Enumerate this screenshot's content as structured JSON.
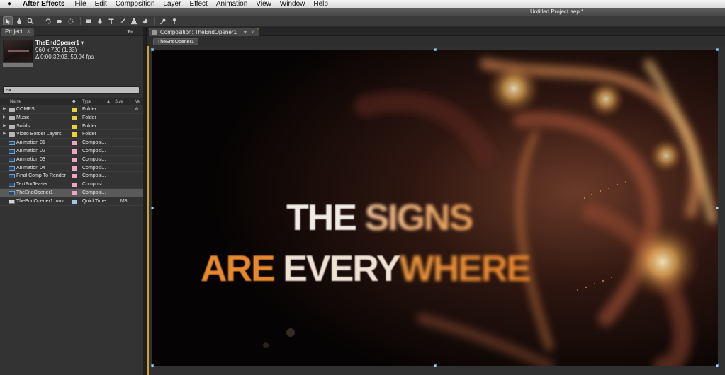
{
  "menubar": {
    "app_name": "After Effects",
    "items": [
      "File",
      "Edit",
      "Composition",
      "Layer",
      "Effect",
      "Animation",
      "View",
      "Window",
      "Help"
    ]
  },
  "window": {
    "title": "Untitled Project.aep *"
  },
  "toolbar": {
    "tools": [
      "selection-tool",
      "hand-tool",
      "zoom-tool",
      "rotation-tool",
      "camera-tool",
      "pan-behind-tool",
      "rectangle-tool",
      "pen-tool",
      "type-tool",
      "brush-tool",
      "clone-stamp-tool",
      "eraser-tool",
      "roto-brush-tool",
      "puppet-pin-tool"
    ]
  },
  "project": {
    "tab_label": "Project",
    "selected_item": {
      "name": "TheEndOpener1 ▾",
      "dimensions": "960 x 720 (1.33)",
      "duration": "Δ 0;00;32;03, 59.94 fps"
    },
    "search_placeholder": "⌕▾",
    "columns": {
      "name": "Name",
      "type": "Type",
      "size": "Size",
      "media": "Me"
    },
    "items": [
      {
        "name": "COMPS",
        "type": "Folder",
        "size": "",
        "kind": "folder",
        "label_color": "#e6d33a",
        "expand": "▶"
      },
      {
        "name": "Music",
        "type": "Folder",
        "size": "",
        "kind": "folder",
        "label_color": "#e6d33a",
        "expand": "▶"
      },
      {
        "name": "Solids",
        "type": "Folder",
        "size": "",
        "kind": "folder",
        "label_color": "#e6d33a",
        "expand": "▶"
      },
      {
        "name": "Video Border Layers",
        "type": "Folder",
        "size": "",
        "kind": "folder",
        "label_color": "#e6d33a",
        "expand": "▶"
      },
      {
        "name": "Animation 01",
        "type": "Composi...",
        "size": "",
        "kind": "comp",
        "label_color": "#e8a7c4",
        "expand": ""
      },
      {
        "name": "Animation 02",
        "type": "Composi...",
        "size": "",
        "kind": "comp",
        "label_color": "#e8a7c4",
        "expand": ""
      },
      {
        "name": "Animation 03",
        "type": "Composi...",
        "size": "",
        "kind": "comp",
        "label_color": "#e8a7c4",
        "expand": ""
      },
      {
        "name": "Animation 04",
        "type": "Composi...",
        "size": "",
        "kind": "comp",
        "label_color": "#e8a7c4",
        "expand": ""
      },
      {
        "name": "Final Comp To Render",
        "type": "Composi...",
        "size": "",
        "kind": "comp",
        "label_color": "#e8a7c4",
        "expand": ""
      },
      {
        "name": "TextForTeaser",
        "type": "Composi...",
        "size": "",
        "kind": "comp",
        "label_color": "#e8a7c4",
        "expand": ""
      },
      {
        "name": "TheEndOpener1",
        "type": "Composi...",
        "size": "",
        "kind": "comp",
        "label_color": "#e8a7c4",
        "expand": "",
        "selected": true
      },
      {
        "name": "TheEndOpener1.mov",
        "type": "QuickTime",
        "size": "...M8",
        "kind": "mov",
        "label_color": "#9fc7e8",
        "expand": ""
      }
    ]
  },
  "composition": {
    "tab_label": "Composition: TheEndOpener1",
    "breadcrumb": "TheEndOpener1",
    "text_line1": {
      "white": "THE ",
      "warm": "SIGNS"
    },
    "text_line2": {
      "orange": "ARE ",
      "white": "EVERY",
      "warm": "WHERE"
    }
  }
}
